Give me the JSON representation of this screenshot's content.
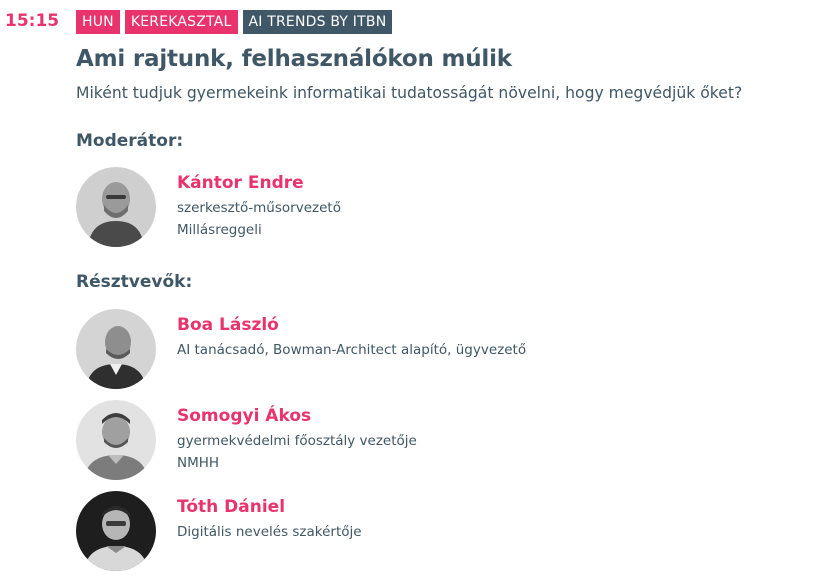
{
  "session": {
    "time": "15:15",
    "tags": [
      "HUN",
      "KEREKASZTAL",
      "AI TRENDS BY ITBN"
    ],
    "title": "Ami rajtunk, felhasználókon múlik",
    "subtitle": "Miként tudjuk gyermekeink informatikai tudatosságát növelni, hogy megvédjük őket?"
  },
  "moderator": {
    "heading": "Moderátor:",
    "name": "Kántor Endre",
    "role": "szerkesztő-műsorvezető",
    "org": "Millásreggeli"
  },
  "participants": {
    "heading": "Résztvevők:",
    "people": [
      {
        "name": "Boa László",
        "role": "AI tanácsadó, Bowman-Architect alapító, ügyvezető",
        "org": ""
      },
      {
        "name": "Somogyi Ákos",
        "role": "gyermekvédelmi főosztály vezetője",
        "org": "NMHH"
      },
      {
        "name": "Tóth Dániel",
        "role": "Digitális nevelés szakértője",
        "org": ""
      }
    ]
  },
  "colors": {
    "accent": "#e8336d",
    "text": "#3f5766",
    "tag_dark": "#3f5766"
  },
  "icons": [
    "avatar-photo"
  ]
}
